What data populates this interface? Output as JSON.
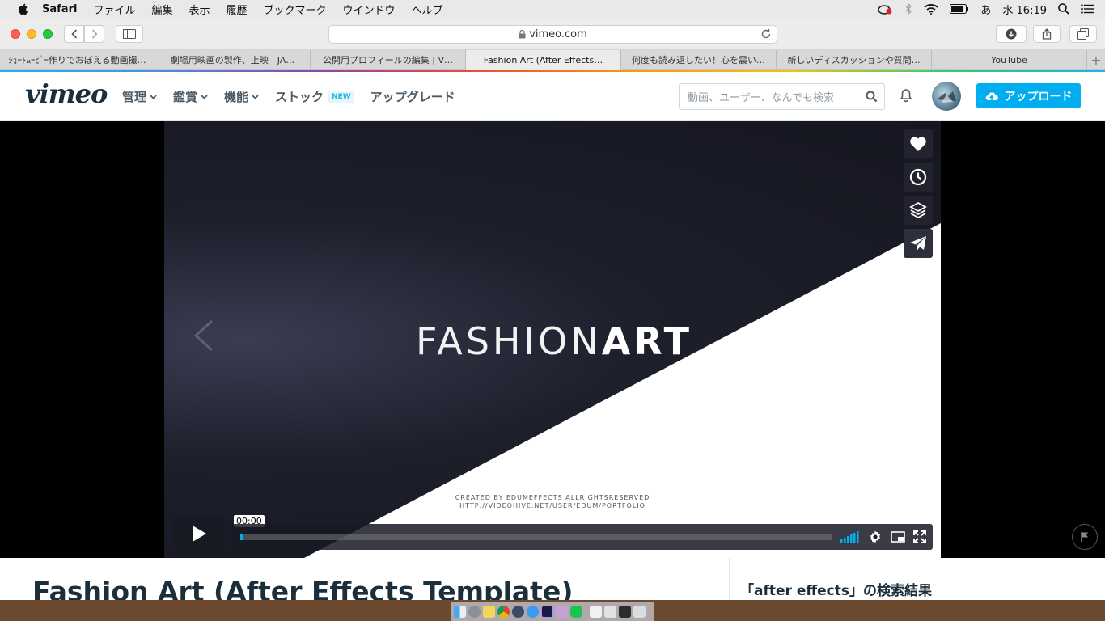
{
  "menubar": {
    "app": "Safari",
    "items": [
      "ファイル",
      "編集",
      "表示",
      "履歴",
      "ブックマーク",
      "ウインドウ",
      "ヘルプ"
    ],
    "ime": "あ",
    "clock": "水 16:19"
  },
  "browser": {
    "url": "vimeo.com",
    "tabs": [
      {
        "label": "ｼｮｰﾄﾑｰﾋﾞｰ作りでおぼえる動画撮…"
      },
      {
        "label": "劇場用映画の製作、上映　JA…"
      },
      {
        "label": "公開用プロフィールの編集 | V…"
      },
      {
        "label": "Fashion Art (After Effects…",
        "active": true
      },
      {
        "label": "何度も読み返したい！心を震い…"
      },
      {
        "label": "新しいディスカッションや質問…"
      },
      {
        "label": "YouTube"
      }
    ],
    "new_tab_symbol": "+"
  },
  "vimeo": {
    "logo": "vimeo",
    "nav": {
      "manage": "管理",
      "watch": "鑑賞",
      "features": "機能",
      "stock": "ストック",
      "stock_badge": "NEW",
      "upgrade": "アップグレード"
    },
    "search_placeholder": "動画、ユーザー、なんでも検索",
    "upload": "アップロード",
    "brand_color": "#00adef"
  },
  "video": {
    "title_thin": "FASHION",
    "title_bold": "ART",
    "credit_line1": "CREATED BY EDUMEFFECTS ALLRIGHTSRESERVED",
    "credit_line2": "HTTP://VIDEOHIVE.NET/USER/EDUM/PORTFOLIO",
    "time_tooltip": "00:00",
    "progress": 0.0
  },
  "page": {
    "video_title": "Fashion Art (After Effects Template)",
    "results_heading": "「after effects」の検索結果"
  }
}
